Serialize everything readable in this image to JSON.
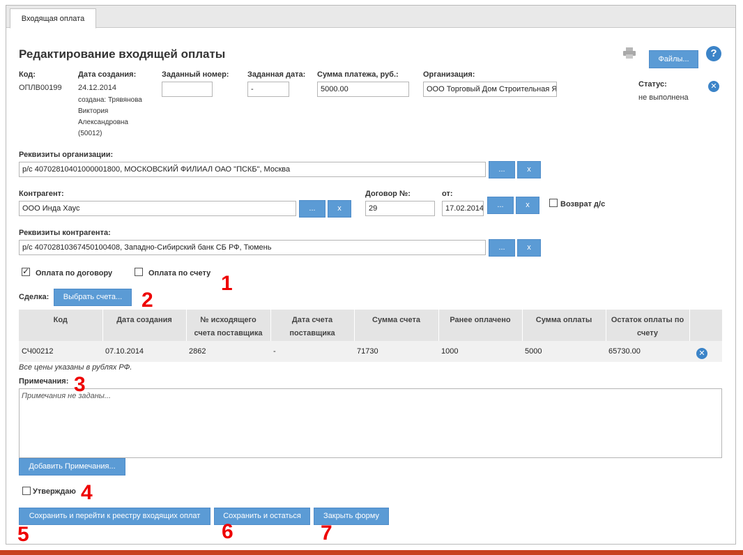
{
  "tab": {
    "label": "Входящая оплата"
  },
  "page": {
    "title": "Редактирование входящей оплаты"
  },
  "toolbar": {
    "files_label": "Файлы...",
    "help_label": "?"
  },
  "header": {
    "code_label": "Код:",
    "code_value": "ОПЛВ00199",
    "created_label": "Дата создания:",
    "created_value": "24.12.2014",
    "created_by_1": "создана: Трявянова",
    "created_by_2": "Виктория",
    "created_by_3": "Александровна",
    "created_by_4": "(50012)",
    "assigned_number_label": "Заданный номер:",
    "assigned_number_value": "",
    "assigned_date_label": "Заданная дата:",
    "assigned_date_value": "-",
    "amount_label": "Сумма платежа, руб.:",
    "amount_value": "5000.00",
    "org_label": "Организация:",
    "org_value": "ООО Торговый Дом Строительная Я",
    "status_label": "Статус:",
    "status_value": "не выполнена"
  },
  "org_details": {
    "label": "Реквизиты организации:",
    "value": "р/с 40702810401000001800, МОСКОВСКИЙ ФИЛИАЛ ОАО \"ПСКБ\", Москва"
  },
  "counterparty": {
    "label": "Контрагент:",
    "value": "ООО Инда Хаус"
  },
  "contract": {
    "label": "Договор №:",
    "value": "29",
    "from_label": "от:",
    "from_value": "17.02.2014"
  },
  "refund": {
    "label": "Возврат д/с"
  },
  "cp_details": {
    "label": "Реквизиты контрагента:",
    "value": "р/с 40702810367450100408, Западно-Сибирский банк СБ РФ, Тюмень"
  },
  "buttons": {
    "dots": "...",
    "x": "x"
  },
  "payment": {
    "by_contract_label": "Оплата по договору",
    "by_invoice_label": "Оплата по счету"
  },
  "deal": {
    "label": "Сделка:",
    "select_label": "Выбрать счета..."
  },
  "table": {
    "headers": [
      [
        "Код",
        ""
      ],
      [
        "Дата создания",
        ""
      ],
      [
        "№ исходящего",
        "счета поставщика"
      ],
      [
        "Дата счета",
        "поставщика"
      ],
      [
        "Сумма счета",
        ""
      ],
      [
        "Ранее оплачено",
        ""
      ],
      [
        "Сумма оплаты",
        ""
      ],
      [
        "Остаток оплаты по",
        "счету"
      ]
    ],
    "rows": [
      [
        "СЧ00212",
        "07.10.2014",
        "2862",
        "-",
        "71730",
        "1000",
        "5000",
        "65730.00"
      ]
    ],
    "footnote": "Все цены указаны в рублях РФ."
  },
  "notes": {
    "label": "Примечания:",
    "placeholder": "Примечания не заданы...",
    "add_label": "Добавить Примечания..."
  },
  "approve": {
    "label": "Утверждаю"
  },
  "actions": {
    "save_go": "Сохранить и перейти к реестру входящих оплат",
    "save_stay": "Сохранить и остаться",
    "close": "Закрыть форму"
  },
  "markers": [
    "1",
    "2",
    "3",
    "4",
    "5",
    "6",
    "7"
  ],
  "colors": {
    "button": "#5b9bd5",
    "marker": "#ee0000",
    "bottom_rule": "#c8411e"
  }
}
